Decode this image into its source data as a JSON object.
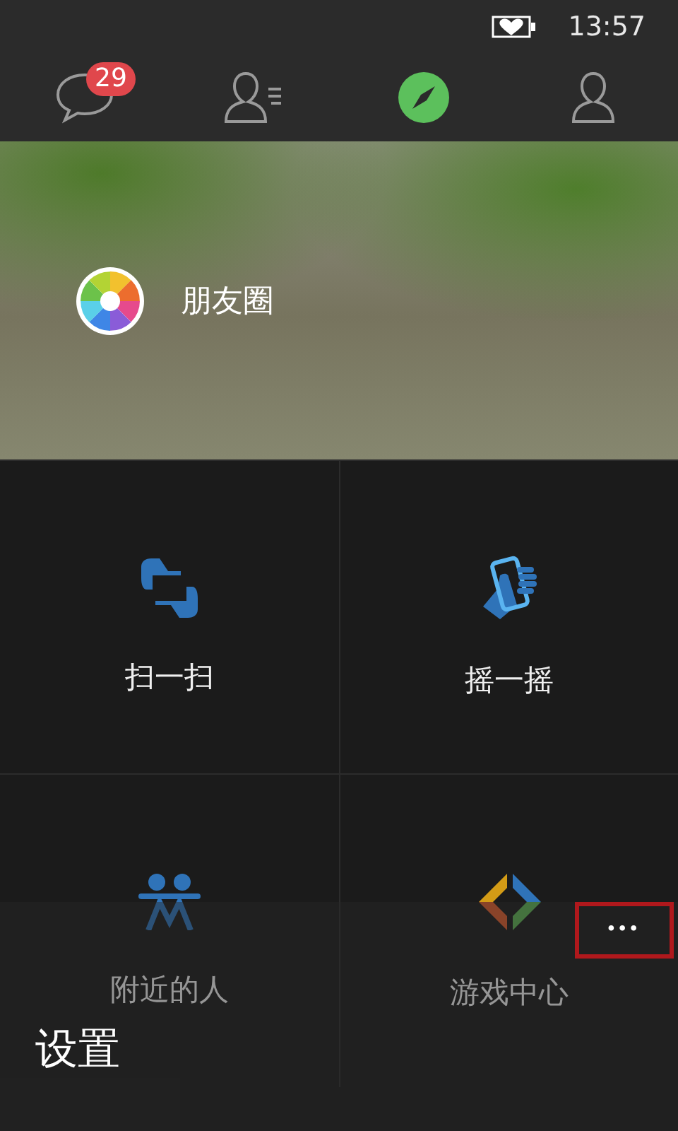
{
  "status_bar": {
    "time": "13:57"
  },
  "tabs": [
    {
      "kind": "chat",
      "selected": false,
      "badge": "29"
    },
    {
      "kind": "contacts",
      "selected": false
    },
    {
      "kind": "discover",
      "selected": true
    },
    {
      "kind": "me",
      "selected": false
    }
  ],
  "banner": {
    "label": "朋友圈"
  },
  "tiles": [
    {
      "kind": "scan",
      "label": "扫一扫"
    },
    {
      "kind": "shake",
      "label": "摇一摇"
    },
    {
      "kind": "nearby",
      "label": "附近的人"
    },
    {
      "kind": "games",
      "label": "游戏中心"
    }
  ],
  "app_bar": {
    "more": "•••",
    "highlighted": true,
    "menu_items": [
      "设置"
    ]
  }
}
